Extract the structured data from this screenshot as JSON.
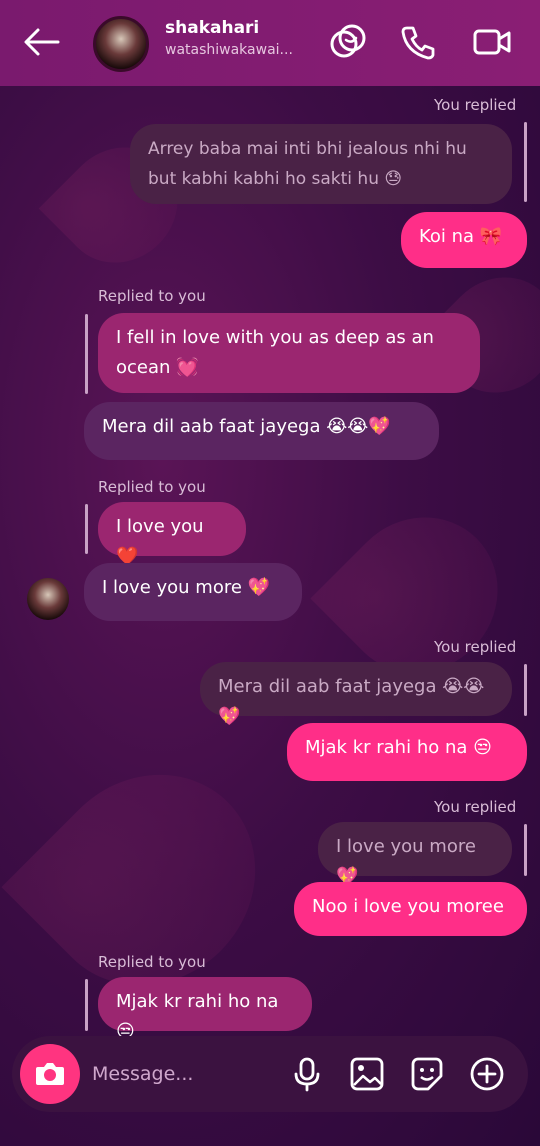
{
  "header": {
    "name": "shakahari",
    "username": "watashiwakawai..."
  },
  "messages": [
    {
      "reply_label": "You replied",
      "quoted": "Arrey baba mai inti bhi jealous nhi hu but kabhi kabhi ho sakti hu 😓",
      "text": "Koi na 🎀"
    },
    {
      "reply_label": "Replied to you",
      "quoted": "I fell in love with you as deep as an ocean 💓",
      "text": "Mera dil aab faat jayega 😭😭💖"
    },
    {
      "reply_label": "Replied to you",
      "quoted": "I love you ❤️",
      "text": "I love you more 💖"
    },
    {
      "reply_label": "You replied",
      "quoted": "Mera dil aab faat jayega 😭😭💖",
      "text": "Mjak kr rahi ho na 😒"
    },
    {
      "reply_label": "You replied",
      "quoted": "I love you more 💖",
      "text": "Noo i love you moree"
    },
    {
      "reply_label": "Replied to you",
      "quoted": "Mjak kr rahi ho na 😒"
    }
  ],
  "composer": {
    "placeholder": "Message..."
  },
  "colors": {
    "header": "#7a1a6e",
    "outgoing": "#ff2e88",
    "incoming": "#5b2561",
    "background": "#3d0d45"
  }
}
